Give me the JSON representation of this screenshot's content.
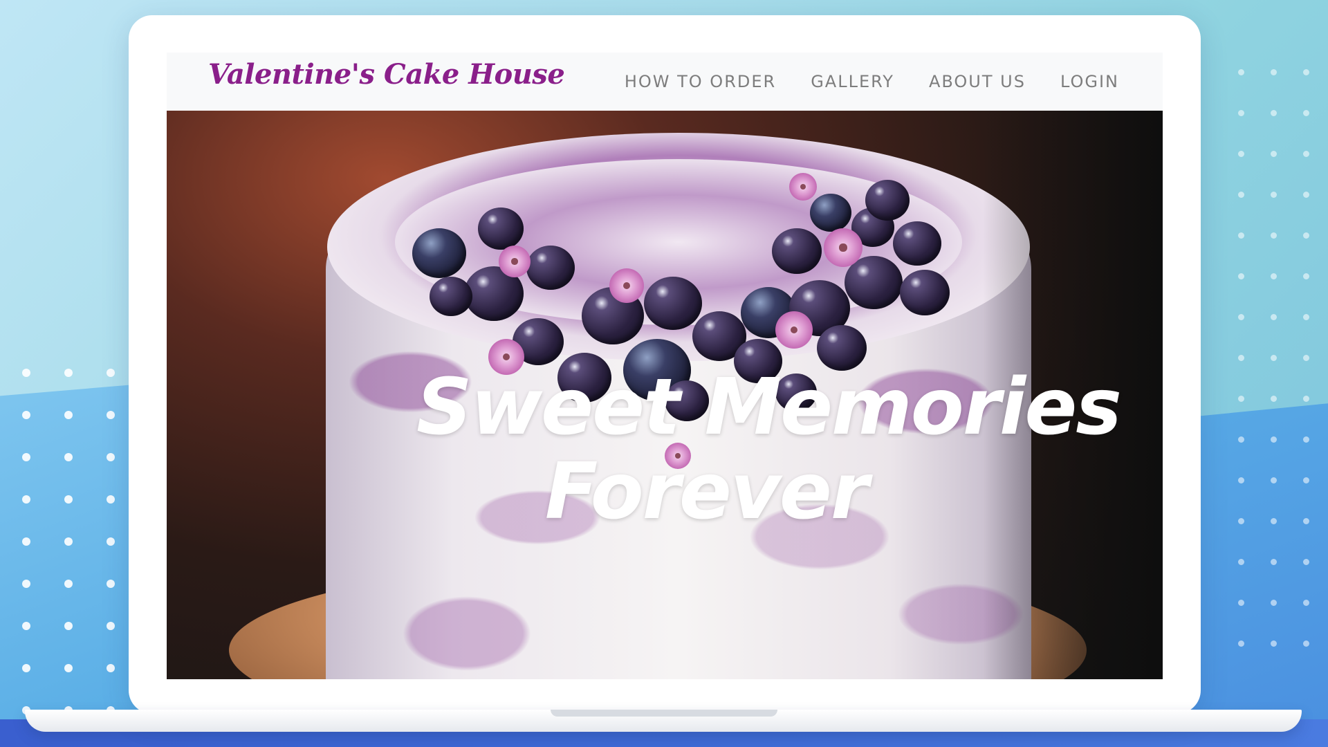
{
  "navbar": {
    "brand": "Valentine's Cake House",
    "links": [
      {
        "label": "HOW TO ORDER"
      },
      {
        "label": "GALLERY"
      },
      {
        "label": "ABOUT US"
      },
      {
        "label": "LOGIN"
      }
    ]
  },
  "hero": {
    "title_line1": "Sweet Memories",
    "title_line2": "Forever",
    "image": "cake-with-blueberries-photo"
  },
  "colors": {
    "brand": "#8a1f8a",
    "nav_text": "#7d7d7d",
    "nav_bg": "#f8f9fa",
    "hero_text": "#ffffff"
  }
}
